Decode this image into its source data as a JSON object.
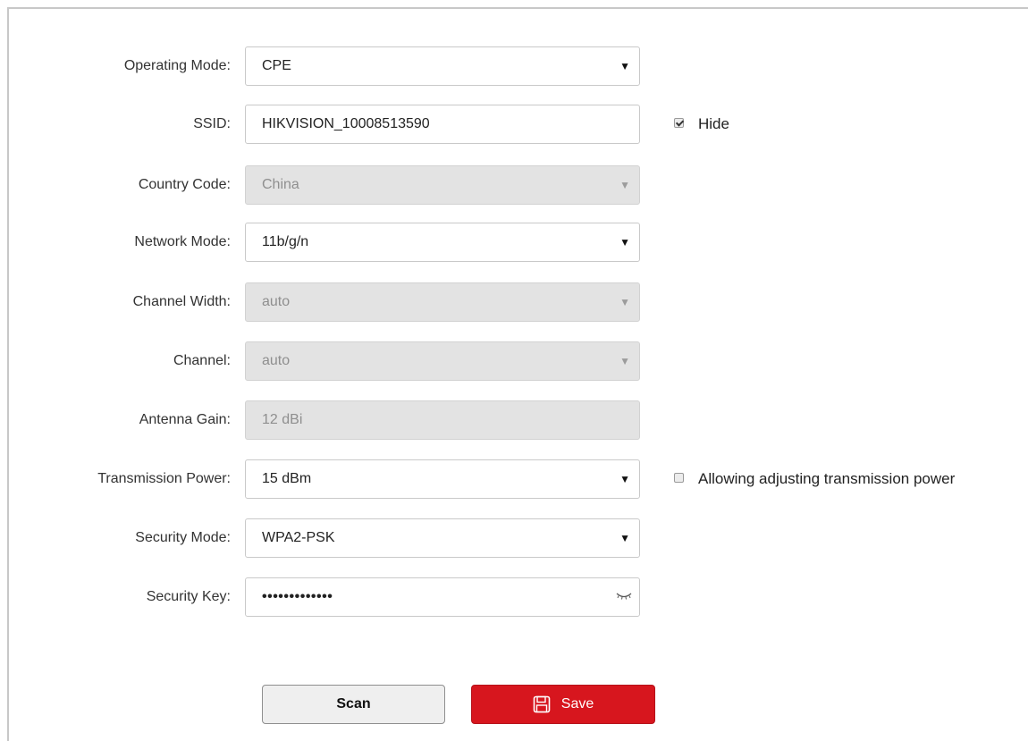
{
  "form": {
    "operating_mode": {
      "label": "Operating Mode:",
      "value": "CPE"
    },
    "ssid": {
      "label": "SSID:",
      "value": "HIKVISION_10008513590",
      "hide_label": "Hide",
      "hide_checked": true
    },
    "country_code": {
      "label": "Country Code:",
      "value": "China"
    },
    "network_mode": {
      "label": "Network Mode:",
      "value": "11b/g/n"
    },
    "channel_width": {
      "label": "Channel Width:",
      "value": "auto"
    },
    "channel": {
      "label": "Channel:",
      "value": "auto"
    },
    "antenna_gain": {
      "label": "Antenna Gain:",
      "value": "12 dBi"
    },
    "transmission_power": {
      "label": "Transmission Power:",
      "value": "15 dBm",
      "adjust_label": "Allowing adjusting transmission power",
      "adjust_checked": false
    },
    "security_mode": {
      "label": "Security Mode:",
      "value": "WPA2-PSK"
    },
    "security_key": {
      "label": "Security Key:",
      "value": "•••••••••••••"
    }
  },
  "buttons": {
    "scan_label": "Scan",
    "save_label": "Save"
  },
  "icons": {
    "dropdown": "dropdown-arrow-icon",
    "eye": "eye-closed-icon",
    "save": "floppy-disk-icon",
    "checkbox": "checkbox-icon"
  },
  "colors": {
    "accent": "#d7161e",
    "disabled_bg": "#e3e3e3",
    "border": "#c9c9c9"
  }
}
